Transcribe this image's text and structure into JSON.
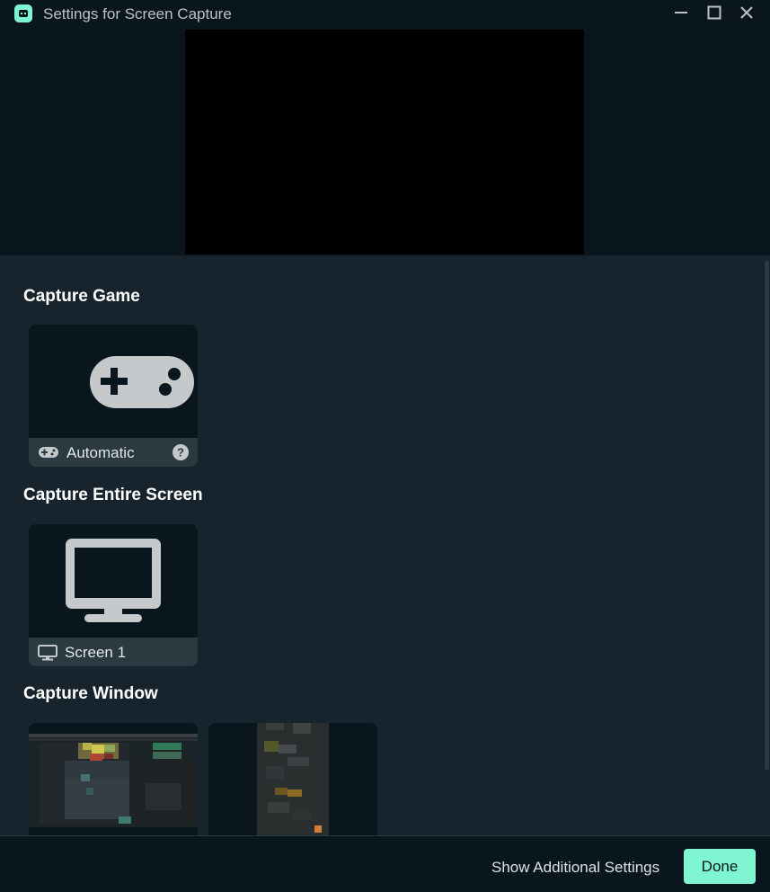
{
  "window": {
    "title": "Settings for Screen Capture"
  },
  "sections": {
    "game": {
      "title": "Capture Game",
      "card_label": "Automatic"
    },
    "screen": {
      "title": "Capture Entire Screen",
      "card_label": "Screen 1"
    },
    "window": {
      "title": "Capture Window"
    }
  },
  "footer": {
    "additional_settings_label": "Show Additional Settings",
    "done_label": "Done"
  },
  "colors": {
    "accent": "#80f5d2",
    "background": "#17242d",
    "panel": "#09161d",
    "card_footer": "#2b3941"
  },
  "icons": {
    "app": "streamlabs-logo-icon",
    "minimize": "minimize-icon",
    "maximize": "maximize-icon",
    "close": "close-icon",
    "gamepad": "gamepad-icon",
    "help": "question-circle-icon",
    "monitor": "monitor-icon"
  }
}
